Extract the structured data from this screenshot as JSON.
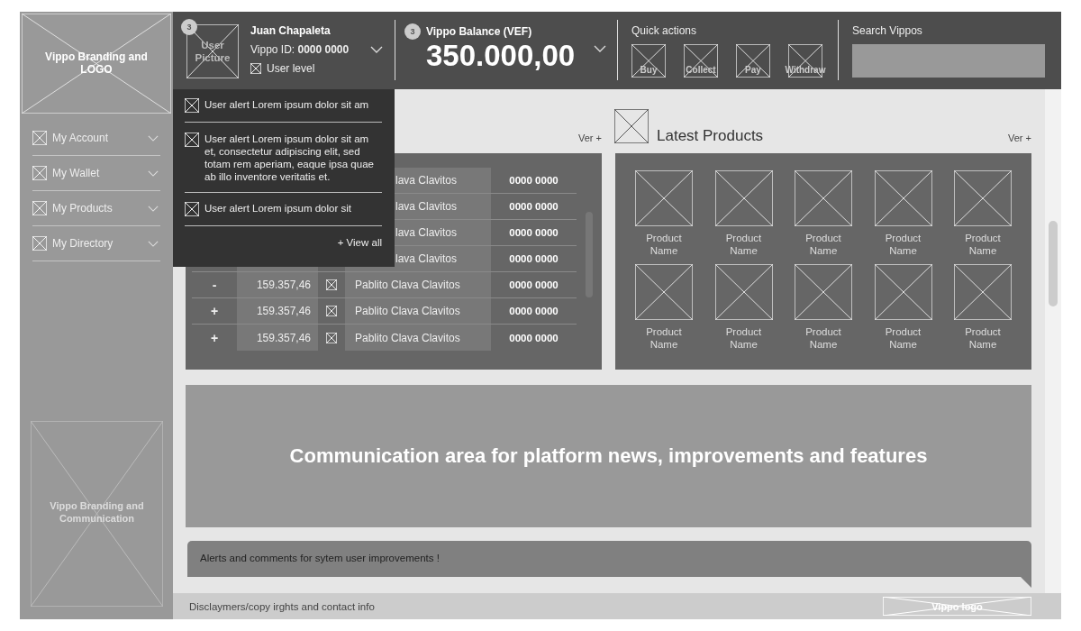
{
  "sidebar": {
    "logo": "Vippo Branding and LOGO",
    "items": [
      {
        "label": "My Account"
      },
      {
        "label": "My Wallet"
      },
      {
        "label": "My Products"
      },
      {
        "label": "My Directory"
      }
    ],
    "banner": "Vippo Branding and Communication"
  },
  "header": {
    "user": {
      "badge": "3",
      "picture": "User Picture",
      "name": "Juan Chapaleta",
      "vippo_id": "Vippo ID: **0000 0000**",
      "level": "User level"
    },
    "balance": {
      "badge": "3",
      "label": "Vippo Balance (VEF)",
      "amount": "350.000,00"
    },
    "quick_actions": {
      "title": "Quick actions",
      "actions": [
        "Buy",
        "Collect",
        "Pay",
        "Withdraw"
      ]
    },
    "search": {
      "label": "Search Vippos"
    }
  },
  "alerts_dropdown": {
    "items": [
      "User alert Lorem ipsum dolor sit am",
      "User alert Lorem ipsum dolor sit am et, consectetur adipiscing elit, sed totam rem aperiam, eaque ipsa quae ab illo inventore veritatis et.",
      "User alert Lorem ipsum dolor sit"
    ],
    "view_all": "+ View all"
  },
  "transactions": {
    "more": "Ver +",
    "rows": [
      {
        "name": "lava Clavitos",
        "id": "0000 0000"
      },
      {
        "name": "lava Clavitos",
        "id": "0000 0000"
      },
      {
        "name": "lava Clavitos",
        "id": "0000 0000"
      },
      {
        "name": "lava Clavitos",
        "id": "0000 0000"
      },
      {
        "sign": "-",
        "amount": "159.357,46",
        "name": "Pablito Clava Clavitos",
        "id": "0000 0000"
      },
      {
        "sign": "+",
        "amount": "159.357,46",
        "name": "Pablito Clava Clavitos",
        "id": "0000 0000"
      },
      {
        "sign": "+",
        "amount": "159.357,46",
        "name": "Pablito Clava Clavitos",
        "id": "0000 0000"
      }
    ]
  },
  "latest_products": {
    "title": "Latest Products",
    "more": "Ver +",
    "products": [
      "Product Name",
      "Product Name",
      "Product Name",
      "Product Name",
      "Product Name",
      "Product Name",
      "Product Name",
      "Product Name",
      "Product Name",
      "Product Name"
    ]
  },
  "communication": "Communication area for platform news, improvements and features",
  "alert_bar": "Alerts and comments for sytem user improvements !",
  "footer": {
    "text": "Disclaymers/copy irghts and contact info",
    "logo": "Vippo logo"
  }
}
